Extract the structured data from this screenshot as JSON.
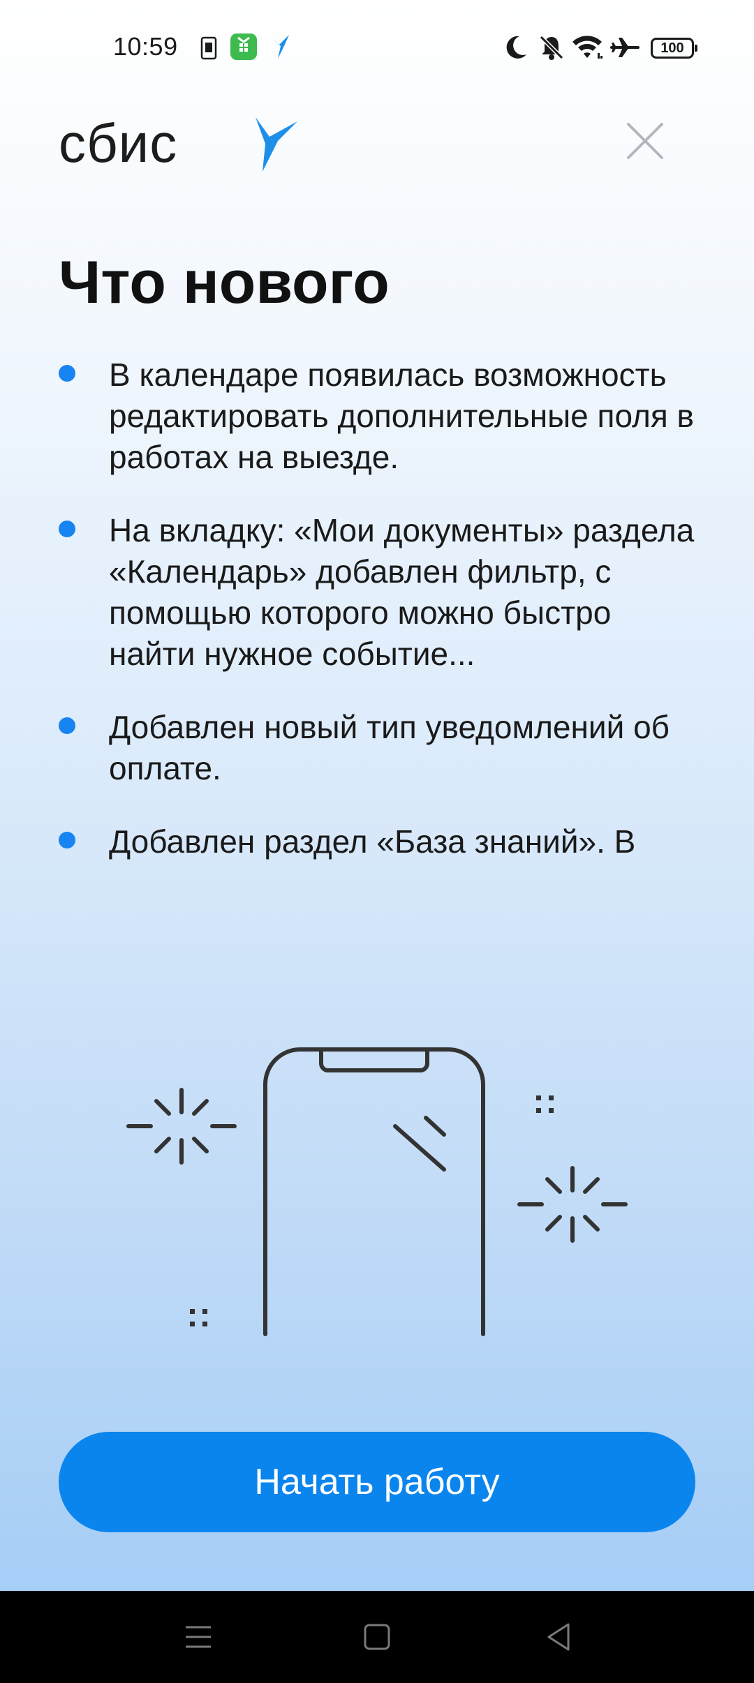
{
  "status_bar": {
    "time": "10:59",
    "battery": "100",
    "icons": [
      "sim-icon",
      "app-icon",
      "sbis-notification-icon",
      "do-not-disturb-moon-icon",
      "muted-bell-icon",
      "wifi-icon",
      "airplane-mode-icon",
      "battery-icon"
    ]
  },
  "header": {
    "logo_text": "сбис",
    "close_icon": "close-icon"
  },
  "title": "Что нового",
  "news": [
    {
      "text": "В календаре появилась возможность редактировать дополнительные поля в работах на выезде."
    },
    {
      "text": "На вкладку: «Мои документы» раздела «Календарь» добавлен фильтр, с помощью которого можно быстро найти нужное событие..."
    },
    {
      "text": "Добавлен новый тип уведомлений об оплате."
    },
    {
      "text": "Добавлен раздел «База знаний». В"
    }
  ],
  "illustration": {
    "icon": "phone-sparkles-illustration"
  },
  "button": {
    "label": "Начать работу"
  },
  "nav_bar": {
    "icons": [
      "menu-icon",
      "home-square-icon",
      "back-triangle-icon"
    ]
  },
  "colors": {
    "accent": "#0b85ee",
    "bullet": "#1784f1",
    "bird": "#1e8fe8"
  }
}
